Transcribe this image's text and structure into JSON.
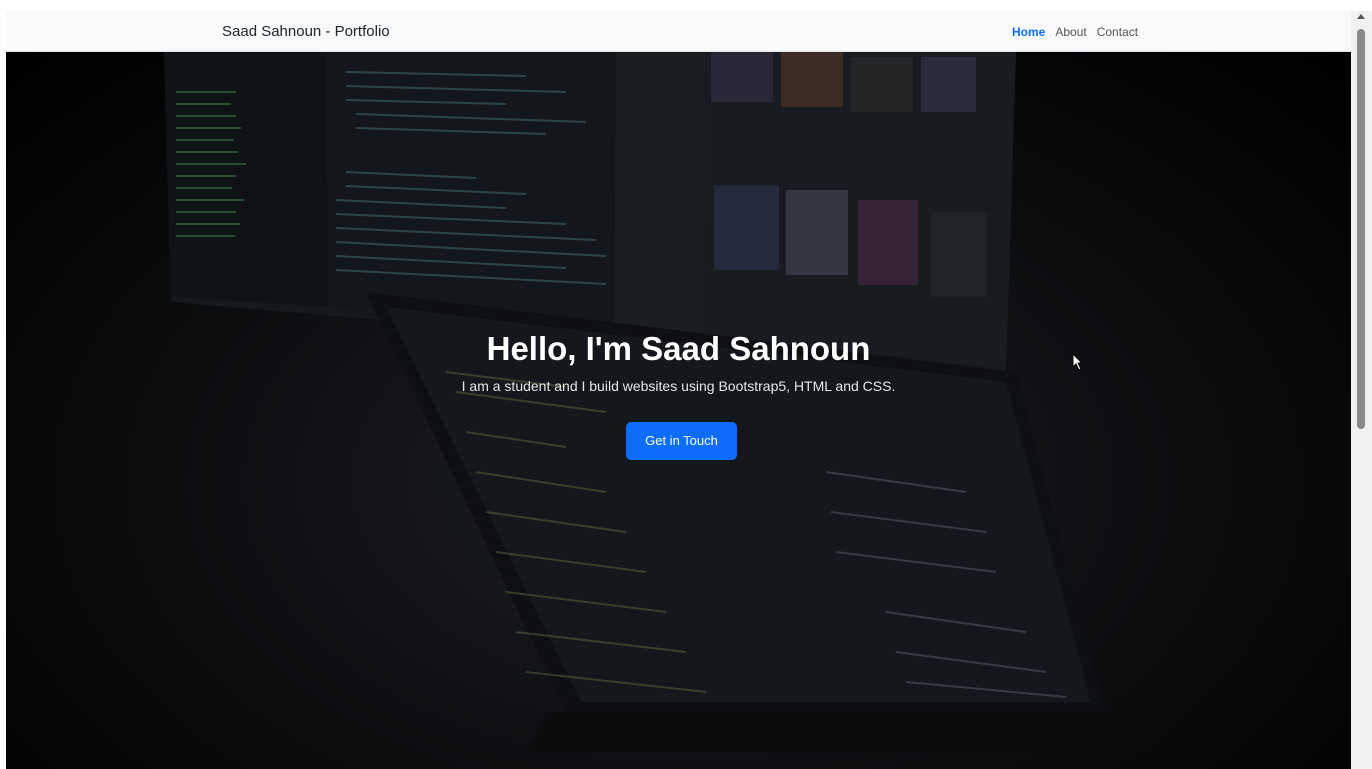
{
  "navbar": {
    "brand": "Saad Sahnoun - Portfolio",
    "links": [
      {
        "label": "Home",
        "active": true
      },
      {
        "label": "About",
        "active": false
      },
      {
        "label": "Contact",
        "active": false
      }
    ]
  },
  "hero": {
    "title": "Hello, I'm Saad Sahnoun",
    "subtitle": "I am a student and I build websites using Bootstrap5, HTML and CSS.",
    "cta_label": "Get in Touch"
  },
  "colors": {
    "accent": "#0d6efd",
    "navbar_bg": "#f8f9fa",
    "hero_text": "#ffffff"
  },
  "icons": {
    "cursor": "mouse-pointer-icon",
    "scroll_up": "scroll-up-arrow-icon"
  }
}
